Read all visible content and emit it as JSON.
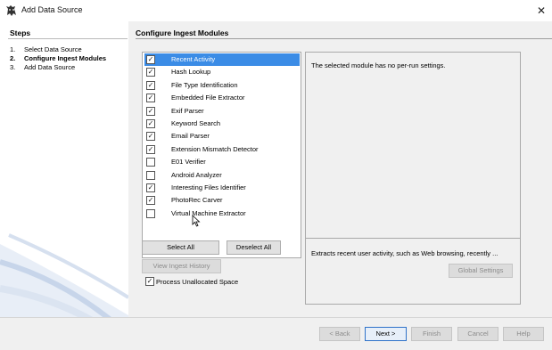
{
  "window": {
    "title": "Add Data Source",
    "close_label": "✕",
    "app_icon": "autopsy-dog-icon"
  },
  "steps": {
    "title": "Steps",
    "items": [
      {
        "num": "1.",
        "label": "Select Data Source",
        "active": false
      },
      {
        "num": "2.",
        "label": "Configure Ingest Modules",
        "active": true
      },
      {
        "num": "3.",
        "label": "Add Data Source",
        "active": false
      }
    ]
  },
  "main": {
    "title": "Configure Ingest Modules",
    "modules": [
      {
        "name": "Recent Activity",
        "checked": true,
        "selected": true
      },
      {
        "name": "Hash Lookup",
        "checked": true
      },
      {
        "name": "File Type Identification",
        "checked": true
      },
      {
        "name": "Embedded File Extractor",
        "checked": true
      },
      {
        "name": "Exif Parser",
        "checked": true
      },
      {
        "name": "Keyword Search",
        "checked": true
      },
      {
        "name": "Email Parser",
        "checked": true
      },
      {
        "name": "Extension Mismatch Detector",
        "checked": true
      },
      {
        "name": "E01 Verifier",
        "checked": false
      },
      {
        "name": "Android Analyzer",
        "checked": false
      },
      {
        "name": "Interesting Files Identifier",
        "checked": true
      },
      {
        "name": "PhotoRec Carver",
        "checked": true
      },
      {
        "name": "Virtual Machine Extractor",
        "checked": false
      }
    ],
    "select_all": "Select All",
    "deselect_all": "Deselect All",
    "view_history": "View Ingest History",
    "process_unallocated": {
      "label": "Process Unallocated Space",
      "checked": true
    },
    "settings_text": "The selected module has no per-run settings.",
    "description": "Extracts recent user activity, such as Web browsing, recently ...",
    "global_settings": "Global Settings"
  },
  "footer": {
    "back": "< Back",
    "next": "Next >",
    "finish": "Finish",
    "cancel": "Cancel",
    "help": "Help"
  },
  "colors": {
    "selection": "#3b8ce6",
    "panel_bg": "#f0f0f0"
  }
}
